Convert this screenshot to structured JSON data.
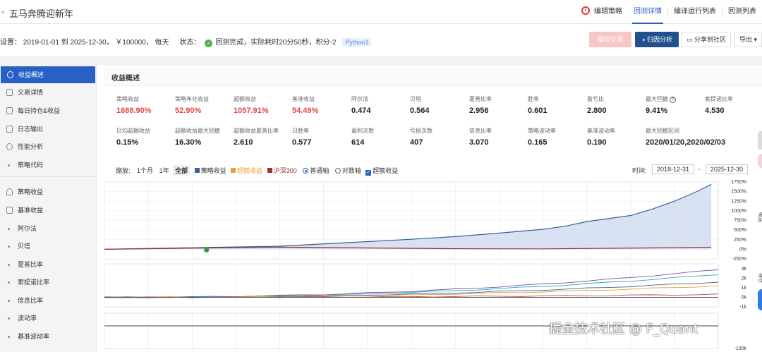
{
  "header": {
    "back_icon": "chevron-left-icon",
    "title": "五马奔腾迎新年",
    "tabs": [
      {
        "label": "编辑策略",
        "icon": "timer-icon"
      },
      {
        "label": "回测详情",
        "active": true
      },
      {
        "label": "编译运行列表"
      },
      {
        "label": "回测列表"
      }
    ]
  },
  "info": {
    "settings": "设置： 2019-01-01 到 2025-12-30， ￥100000， 每天",
    "status_label": "状态：",
    "status_text": "回测完成，实际耗时20分50秒，积分-2",
    "language": "Python3"
  },
  "actions": {
    "simulate": "模拟交易",
    "attribution": "归因分析",
    "share": "分享到社区",
    "export": "导出"
  },
  "sidebar": {
    "items": [
      {
        "label": "收益概述",
        "active": true
      },
      {
        "label": "交易详情"
      },
      {
        "label": "每日持仓&收益"
      },
      {
        "label": "日志输出"
      },
      {
        "label": "性能分析"
      },
      {
        "label": "策略代码",
        "sub": true
      },
      {
        "label": "策略收益"
      },
      {
        "label": "基准收益"
      },
      {
        "label": "阿尔法",
        "sub": true
      },
      {
        "label": "贝塔",
        "sub": true
      },
      {
        "label": "夏普比率",
        "sub": true
      },
      {
        "label": "索提诺比率",
        "sub": true
      },
      {
        "label": "信息比率",
        "sub": true
      },
      {
        "label": "波动率",
        "sub": true
      },
      {
        "label": "基准波动率",
        "sub": true
      }
    ]
  },
  "section": {
    "title": "收益概述"
  },
  "stats_row1": [
    {
      "label": "策略收益",
      "value": "1688.90%",
      "red": true
    },
    {
      "label": "策略年化收益",
      "value": "52.90%",
      "red": true
    },
    {
      "label": "超额收益",
      "value": "1057.91%",
      "red": true
    },
    {
      "label": "基准收益",
      "value": "54.49%",
      "red": true
    },
    {
      "label": "阿尔法",
      "value": "0.474"
    },
    {
      "label": "贝塔",
      "value": "0.564"
    },
    {
      "label": "夏普比率",
      "value": "2.956"
    },
    {
      "label": "胜率",
      "value": "0.601"
    },
    {
      "label": "盈亏比",
      "value": "2.800"
    },
    {
      "label": "最大回撤",
      "value": "9.41%",
      "help": true
    },
    {
      "label": "索提诺比率",
      "value": "4.530"
    }
  ],
  "stats_row2": [
    {
      "label": "日均超额收益",
      "value": "0.15%"
    },
    {
      "label": "超额收益最大回撤",
      "value": "16.30%"
    },
    {
      "label": "超额收益夏普比率",
      "value": "2.610"
    },
    {
      "label": "日胜率",
      "value": "0.577"
    },
    {
      "label": "盈利次数",
      "value": "614"
    },
    {
      "label": "亏损次数",
      "value": "407"
    },
    {
      "label": "信息比率",
      "value": "3.070"
    },
    {
      "label": "策略波动率",
      "value": "0.165"
    },
    {
      "label": "基准波动率",
      "value": "0.190"
    },
    {
      "label": "最大回撤区间",
      "value": "2020/01/20,2020/02/03"
    }
  ],
  "controls": {
    "zoom_label": "缩放:",
    "zoom_options": [
      "1个月",
      "1年",
      "全部"
    ],
    "zoom_active": "全部",
    "legend": [
      {
        "label": "策略收益",
        "color": "#3b5e9c"
      },
      {
        "label": "超额收益",
        "color": "#e8a030"
      },
      {
        "label": "沪深300",
        "color": "#9c2f2f"
      }
    ],
    "axis_modes": [
      "普通轴",
      "对数轴"
    ],
    "axis_active": "普通轴",
    "excess_checkbox": "超额收益",
    "time_label": "时间:",
    "date_from": "2018-12-31",
    "date_to": "2025-12-30"
  },
  "chart_data": {
    "type": "line",
    "title": "",
    "ylabel": "",
    "ylim": [
      -250,
      1750
    ],
    "yticks": [
      "1750%",
      "1500%",
      "1250%",
      "1000%",
      "750%",
      "500%",
      "250%",
      "0%",
      "-250%"
    ],
    "xlim": [
      "2019-01-01",
      "2025-12-30"
    ],
    "series": [
      {
        "name": "策略收益",
        "color": "#3b5e9c",
        "x": [
          "2019-01",
          "2019-07",
          "2020-01",
          "2020-07",
          "2021-01",
          "2021-07",
          "2022-01",
          "2022-07",
          "2023-01",
          "2023-07",
          "2024-01",
          "2024-04",
          "2024-07",
          "2024-10",
          "2025-01",
          "2025-04",
          "2025-07",
          "2025-10",
          "2025-12"
        ],
        "values": [
          0,
          20,
          40,
          60,
          80,
          140,
          200,
          260,
          330,
          420,
          520,
          600,
          720,
          800,
          880,
          1050,
          1250,
          1500,
          1689
        ]
      },
      {
        "name": "超额收益",
        "color": "#e8a030",
        "x": [
          "2019-01",
          "2020-01",
          "2021-01",
          "2022-01",
          "2023-01",
          "2024-01",
          "2025-01",
          "2025-12"
        ],
        "values": [
          0,
          30,
          60,
          140,
          250,
          420,
          700,
          1058
        ]
      },
      {
        "name": "沪深300",
        "color": "#9c2f2f",
        "x": [
          "2019-01",
          "2020-01",
          "2021-01",
          "2022-01",
          "2023-01",
          "2024-01",
          "2025-01",
          "2025-12"
        ],
        "values": [
          0,
          30,
          55,
          35,
          15,
          10,
          30,
          54
        ]
      }
    ],
    "sub_panel_ticks": [
      "3k",
      "2k",
      "1k",
      "0k",
      "-1k"
    ],
    "sub_panel2_ticks": [
      "-100k"
    ],
    "grid": true
  },
  "sub_axis_labels": [
    "收益",
    "持仓"
  ],
  "watermark": "掘金技术社区 @ F_Quant"
}
